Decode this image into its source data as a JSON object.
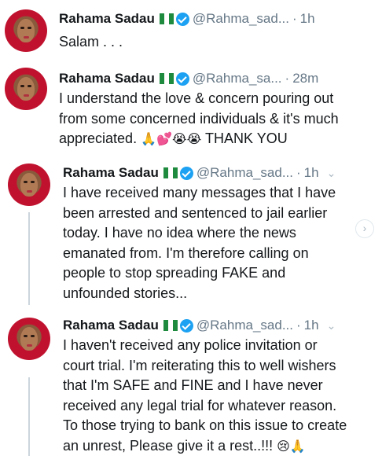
{
  "tweets": [
    {
      "name": "Rahama Sadau",
      "handle": "@Rahma_sad...",
      "separator": "·",
      "time": "1h",
      "lines": [
        "Salam . . ."
      ]
    },
    {
      "name": "Rahama Sadau",
      "handle": "@Rahma_sa...",
      "separator": "·",
      "time": "28m",
      "lines": [
        "I understand the love & concern pouring out",
        "from some concerned individuals & it's much",
        "appreciated.",
        "THANK YOU"
      ],
      "emojis": "🙏💕😭😭"
    },
    {
      "name": "Rahama Sadau",
      "handle": "@Rahma_sad...",
      "separator": "·",
      "time": "1h",
      "chevron": "⌄",
      "lines": [
        "I have received many messages that I have",
        "been arrested and sentenced to jail earlier",
        "today. I have no idea where the news",
        "emanated from. I'm therefore calling on",
        "people to stop spreading FAKE and",
        "unfounded stories..."
      ]
    },
    {
      "name": "Rahama Sadau",
      "handle": "@Rahma_sad...",
      "separator": "·",
      "time": "1h",
      "chevron": "⌄",
      "lines": [
        "I haven't received any police invitation or",
        "court trial. I'm reiterating this to well wishers",
        "that I'm SAFE and FINE and I have never",
        "received any legal trial for whatever reason.",
        "To those trying to bank on this issue to create",
        "an unrest, Please give it a rest..!!!"
      ],
      "emojis": "😢🙏"
    }
  ],
  "icons": {
    "flag": "nigeria-flag-icon",
    "verified": "verified-badge-icon",
    "chevron": "chevron-down-icon",
    "next": "chevron-right-icon"
  },
  "colors": {
    "verified": "#1da1f2",
    "muted": "#657786",
    "flag_green": "#1e8a3e",
    "avatar_scarf": "#c0122f"
  }
}
